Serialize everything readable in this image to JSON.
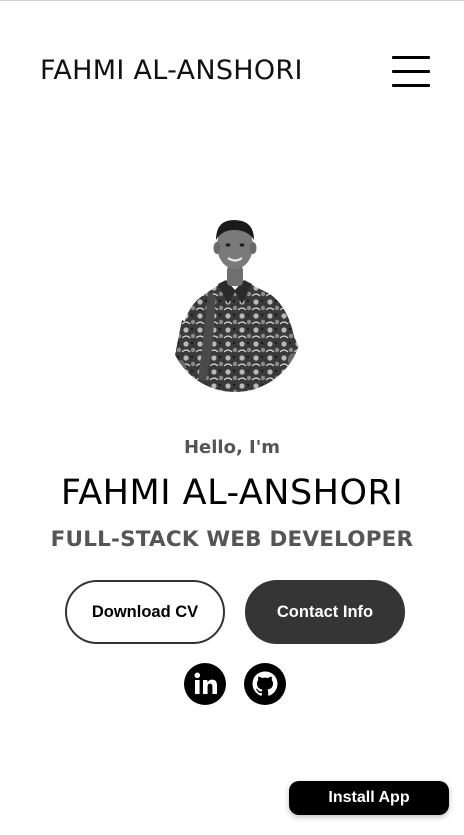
{
  "header": {
    "logo_text": "FAHMI AL-ANSHORI",
    "menu_icon": "hamburger-menu-icon"
  },
  "hero": {
    "avatar_icon": "profile-photo",
    "greeting": "Hello, I'm",
    "name": "FAHMI AL-ANSHORI",
    "role": "FULL-STACK WEB DEVELOPER"
  },
  "actions": {
    "download_label": "Download CV",
    "contact_label": "Contact Info"
  },
  "social": {
    "linkedin_icon": "linkedin-icon",
    "github_icon": "github-icon"
  },
  "install": {
    "label": "Install App"
  },
  "colors": {
    "primary": "#000000",
    "secondary_text": "#555555",
    "contact_button_bg": "#353535",
    "background": "#ffffff"
  }
}
